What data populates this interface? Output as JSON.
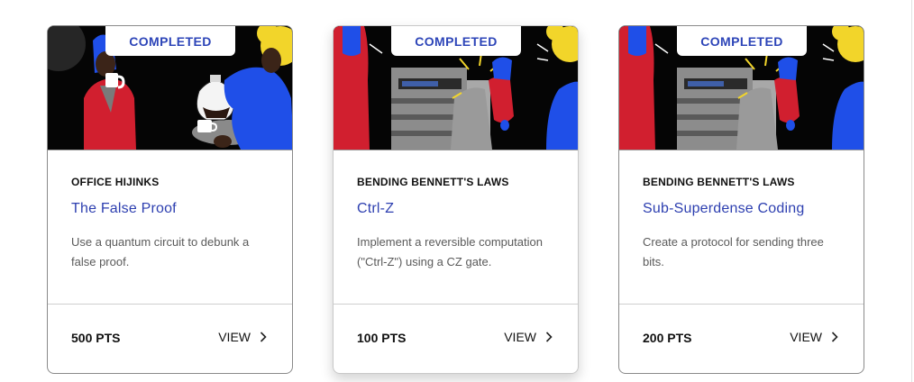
{
  "cards": [
    {
      "badge": "COMPLETED",
      "category": "OFFICE HIJINKS",
      "title": "The False Proof",
      "description": "Use a quantum circuit to debunk a false proof.",
      "points": "500 PTS",
      "view_label": "VIEW"
    },
    {
      "badge": "COMPLETED",
      "category": "BENDING BENNETT'S LAWS",
      "title": "Ctrl-Z",
      "description": "Implement a reversible computation (\"Ctrl-Z\") using a CZ gate.",
      "points": "100 PTS",
      "view_label": "VIEW"
    },
    {
      "badge": "COMPLETED",
      "category": "BENDING BENNETT'S LAWS",
      "title": "Sub-Superdense Coding",
      "description": "Create a protocol for sending three bits.",
      "points": "200 PTS",
      "view_label": "VIEW"
    }
  ],
  "colors": {
    "accent_blue": "#2d45b8",
    "illustration_red": "#d11f2f",
    "illustration_blue": "#1f4fe8",
    "illustration_yellow": "#f2d52a"
  },
  "icons": [
    "chevron-right-icon",
    "coffee-illustration",
    "copier-illustration"
  ]
}
